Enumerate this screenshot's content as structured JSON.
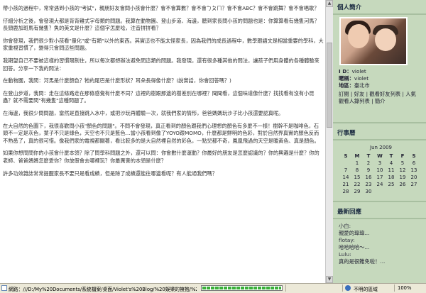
{
  "post": {
    "paragraphs": [
      "帶小孩的過程中，常常遇到小孩的\"考試\"，親朋好友會問小孩會什麼？會不會算數？會不會ㄅㄆㄇ？會不會ABC？會不會跳舞？會不會唱歌？",
      "仔細分析之後，會發現大都是背背雞式字母類的問題。我算在動物園、登山步道、海邊，聽到家長問小孩的問題也是：你算算看有幾隻河馬？長頸鹿加斑馬有幾隻？魚的英文是什麼？這個字怎麼唸，注音拼拼看？",
      "你會發現，我們很少對小孩看\"量化\"或\"有類\"以外的東西。其實這也不能太怪家長，因為我們的成長過程中，數學跟語文是相當重要的學科，大家重視習慣了，變得只會問這些問題。",
      "我期望自己不要被這樣的習慣限制住，所以每次都想辦法避免問這類的問題。我發現，還有很多種其他的問法，讓孩子們用身體的各種體驗來回答。分享一下我的問法：",
      "在動物園，我問：河馬是什麼顏色？牠的尾巴是什麼形狀？耳朵長得像什麼？(說實話，你會回答嗎？)",
      "在登山步道，我問：走在這條路走在那條感覺有什麼不同？這裡的樹跟那邊的樹差別在哪裡？聞聞看，這個味道像什麼？找找看有沒有小昆蟲？就不需要問\"有幾隻\"這種問題了。",
      "在海邊，我很少問問題，當然是直接跳入水中，或把沙玩再體驗一次，就我們家的情形，爸爸媽媽玩沙子比小孩還要認真呢。",
      "在大自然的色圖下，我很喜歡問小孩\"顏色的問題\"。不問不會發現，真正看到的顏色跟我們心理想的顏色有多麼不一樣！樹幹不是咖啡色，石頭不一定是灰色，葉子不只是綠色，天空也不只是藍色…當小孩看到像了YOYO跟MOMO，什麼都是鮮明的色彩，對於自然界真實的顏色反而不熟悉了，真的很可惜。像我們家的電視都關著，看比較多的是大自然裡自然的彩色，一點兒都不奇，鳳凰飛過的天空是暖黃色、真是顏色。",
      "如果你想問問你的小孩會什麼本領？除了問學科問題之外，還可以問：你會數什麼運動？你最好的朋友是怎麼認識的？你的興趣是什麼？你的老師、爸爸媽媽怎麼愛你？你放假會去哪裡玩？你最厲害的本領是什麼？",
      "許多功效雜誌常常提醒家長不要只是看成績，但是除了成績還能往哪邊看呢？有人能通我們嗎？"
    ]
  },
  "sidebar": {
    "profile_title": "個人簡介",
    "id_label": "I D：",
    "id_value": "violet",
    "nickname_label": "暱稱：",
    "nickname_value": "violet",
    "region_label": "地區：",
    "region_value": "臺北市",
    "subscribe_link": "訂閱",
    "friend_link": "好友",
    "add_friend_link": "觀看好友列表",
    "popularity_link": "人氣",
    "view_people_link": "觀看人錄列表",
    "intro_link": "簡介",
    "calendar_title": "行事曆",
    "calendar_month": "Jun 2009",
    "calendar_days": [
      "S",
      "M",
      "T",
      "W",
      "T",
      "F",
      "S"
    ],
    "calendar_weeks": [
      [
        "",
        "1",
        "2",
        "3",
        "4",
        "5",
        "6"
      ],
      [
        "7",
        "8",
        "9",
        "10",
        "11",
        "12",
        "13"
      ],
      [
        "14",
        "15",
        "16",
        "17",
        "18",
        "19",
        "20"
      ],
      [
        "21",
        "22",
        "23",
        "24",
        "25",
        "26",
        "27"
      ],
      [
        "28",
        "29",
        "30",
        "",
        "",
        "",
        ""
      ]
    ],
    "comments_title": "最新回應",
    "comments": [
      {
        "name": "小白:",
        "text": "親愛的瑋瑋..."
      },
      {
        "name": "flotay:",
        "text": "哈哈哈哈～..."
      },
      {
        "name": "Lulu:",
        "text": "真的是很難免啦！..."
      }
    ]
  },
  "statusbar": {
    "text": "網路：///D:/My%20Documents/系統檔案/桌面/Violet's%20Blog/%20娛樂的擁抱/%20你有什麼",
    "zone": "不明的區域",
    "zoom": "100%",
    "progress": 1.0
  },
  "colors": {
    "sidebar_bg": "#c6d9bd",
    "statusbar_bg": "#ece9d8"
  }
}
